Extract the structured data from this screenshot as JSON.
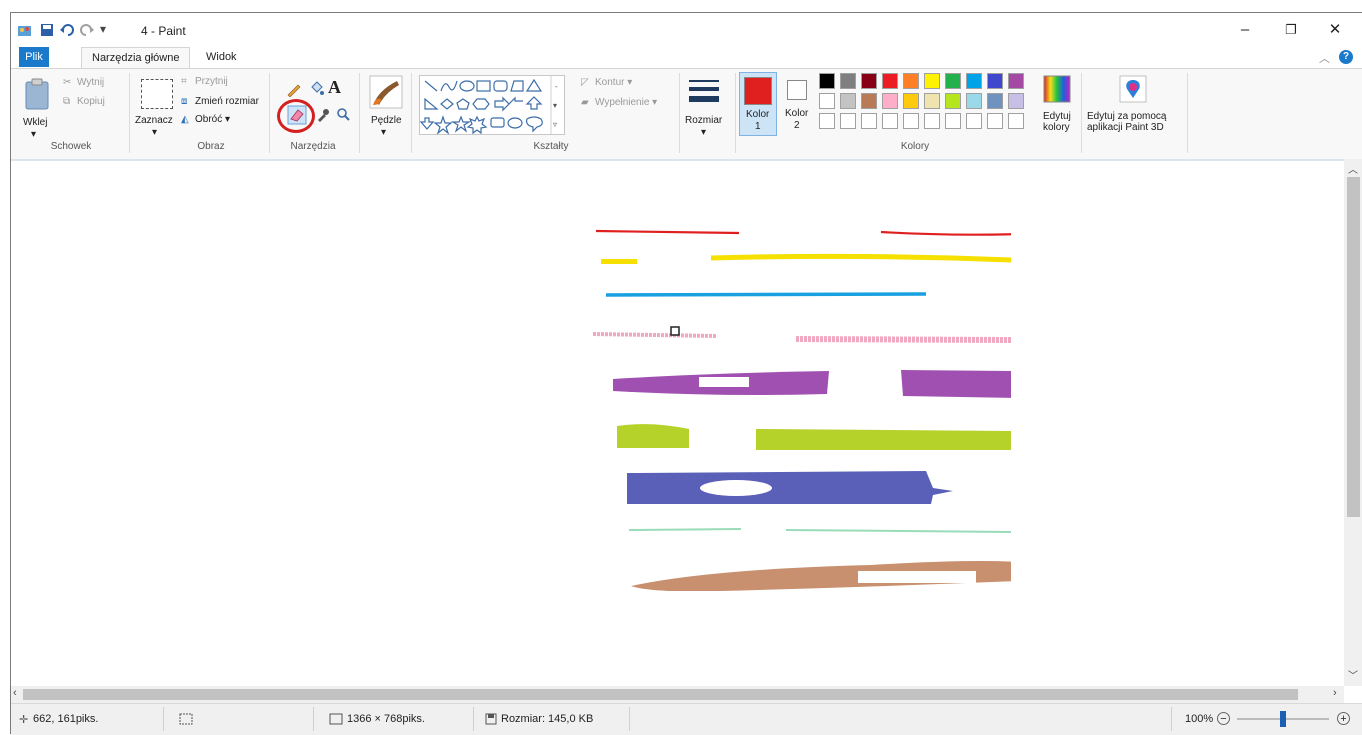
{
  "window": {
    "title": "4 - Paint",
    "controls": {
      "minimize": "–",
      "maximize": "❐",
      "close": "✕"
    }
  },
  "tabs": [
    {
      "label": "Plik"
    },
    {
      "label": "Narzędzia główne"
    },
    {
      "label": "Widok"
    }
  ],
  "ribbon": {
    "clipboard": {
      "paste": "Wklej",
      "cut": "Wytnij",
      "copy": "Kopiuj",
      "group": "Schowek"
    },
    "image": {
      "select": "Zaznacz",
      "crop": "Przytnij",
      "resize": "Zmień rozmiar",
      "rotate": "Obróć ▾",
      "group": "Obraz"
    },
    "tools": {
      "group": "Narzędzia",
      "text_icon": "A"
    },
    "brushes": {
      "label": "Pędzle"
    },
    "shapes": {
      "outline": "Kontur ▾",
      "fill": "Wypełnienie ▾",
      "group": "Kształty"
    },
    "size": {
      "label": "Rozmiar"
    },
    "colors": {
      "color1_line1": "Kolor",
      "color1_line2": "1",
      "color2_line1": "Kolor",
      "color2_line2": "2",
      "edit_line1": "Edytuj",
      "edit_line2": "kolory",
      "group": "Kolory",
      "color1": "#e0201f",
      "color2": "#ffffff",
      "palette_row1": [
        "#000000",
        "#7f7f7f",
        "#880015",
        "#ed1c24",
        "#ff7f27",
        "#fff200",
        "#22b14c",
        "#00a2e8",
        "#3f48cc",
        "#a349a4"
      ],
      "palette_row2": [
        "#ffffff",
        "#c3c3c3",
        "#b97a57",
        "#ffaec9",
        "#ffc90e",
        "#efe4b0",
        "#b5e61d",
        "#99d9ea",
        "#7092be",
        "#c8bfe7"
      ]
    },
    "paint3d": {
      "line1": "Edytuj za pomocą",
      "line2": "aplikacji Paint 3D"
    }
  },
  "status": {
    "cursor_pos": "662, 161piks.",
    "dimensions": "1366 × 768piks.",
    "file_size": "Rozmiar: 145,0 KB",
    "zoom": "100%",
    "zoom_fraction": 0.5
  }
}
